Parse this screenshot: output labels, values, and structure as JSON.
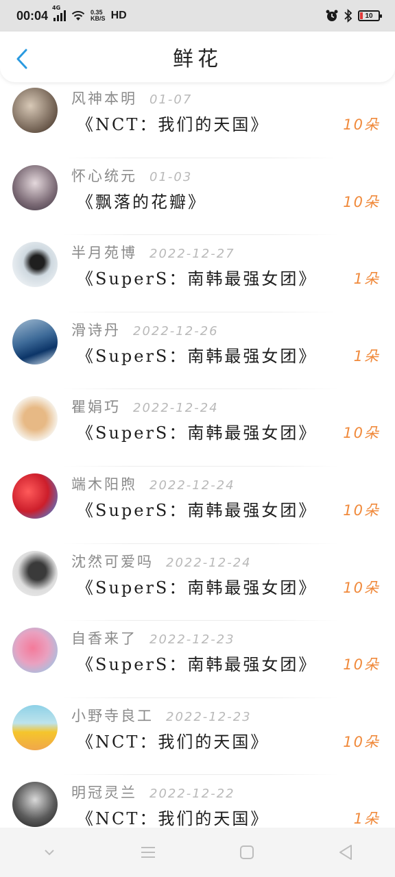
{
  "status_bar": {
    "time": "00:04",
    "network": "4G",
    "speed_value": "0.35",
    "speed_unit": "KB/S",
    "hd": "HD",
    "battery": "10"
  },
  "header": {
    "title": "鲜花"
  },
  "gifts": [
    {
      "name": "风神本明",
      "date": "01-07",
      "title": "《NCT：我们的天国》",
      "count": "10朵"
    },
    {
      "name": "怀心统元",
      "date": "01-03",
      "title": "《飘落的花瓣》",
      "count": "10朵"
    },
    {
      "name": "半月苑博",
      "date": "2022-12-27",
      "title": "《SuperS：南韩最强女团》",
      "count": "1朵"
    },
    {
      "name": "滑诗丹",
      "date": "2022-12-26",
      "title": "《SuperS：南韩最强女团》",
      "count": "1朵"
    },
    {
      "name": "瞿娟巧",
      "date": "2022-12-24",
      "title": "《SuperS：南韩最强女团》",
      "count": "10朵"
    },
    {
      "name": "端木阳煦",
      "date": "2022-12-24",
      "title": "《SuperS：南韩最强女团》",
      "count": "10朵"
    },
    {
      "name": "沈然可爱吗",
      "date": "2022-12-24",
      "title": "《SuperS：南韩最强女团》",
      "count": "10朵"
    },
    {
      "name": "自香来了",
      "date": "2022-12-23",
      "title": "《SuperS：南韩最强女团》",
      "count": "10朵"
    },
    {
      "name": "小野寺良工",
      "date": "2022-12-23",
      "title": "《NCT：我们的天国》",
      "count": "10朵"
    },
    {
      "name": "明冠灵兰",
      "date": "2022-12-22",
      "title": "《NCT：我们的天国》",
      "count": "1朵"
    }
  ],
  "colors": {
    "accent": "#2a9ae0",
    "count": "#f08a3c"
  },
  "nav_bar": [
    "chevron-down-icon",
    "menu-icon",
    "home-square-icon",
    "back-triangle-icon"
  ]
}
